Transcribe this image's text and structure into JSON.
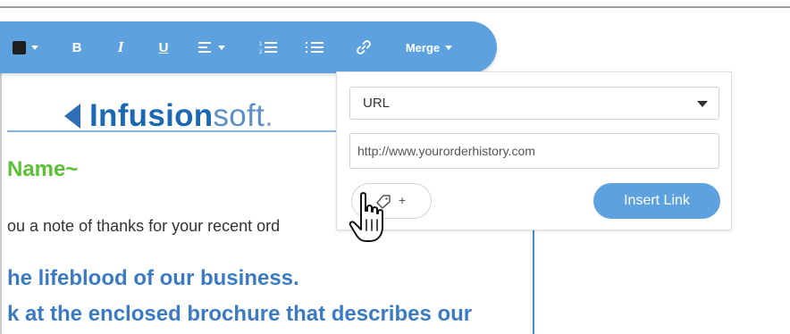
{
  "toolbar": {
    "items": [
      {
        "name": "text-color",
        "icon": "color-swatch-icon",
        "color": "#1f1f1f"
      },
      {
        "name": "bold",
        "label": "B"
      },
      {
        "name": "italic",
        "label": "I"
      },
      {
        "name": "underline",
        "label": "U"
      },
      {
        "name": "align",
        "icon": "align-left-icon"
      },
      {
        "name": "ordered-list",
        "icon": "ordered-list-icon"
      },
      {
        "name": "bullet-list",
        "icon": "bullet-list-icon"
      },
      {
        "name": "link",
        "icon": "link-icon"
      }
    ],
    "merge_label": "Merge",
    "accent": "#5da2de"
  },
  "email": {
    "logo": {
      "bold": "Infusion",
      "light": "soft",
      "dot": "."
    },
    "greeting": "Name~",
    "paragraph": "ou a note of thanks for your recent ord",
    "headline_1": "he lifeblood of our business.",
    "headline_2": "k at the enclosed brochure that describes our"
  },
  "link_panel": {
    "type_value": "URL",
    "url_value": "http://www.yourorderhistory.com",
    "tag_plus": "+",
    "insert_label": "Insert Link"
  }
}
